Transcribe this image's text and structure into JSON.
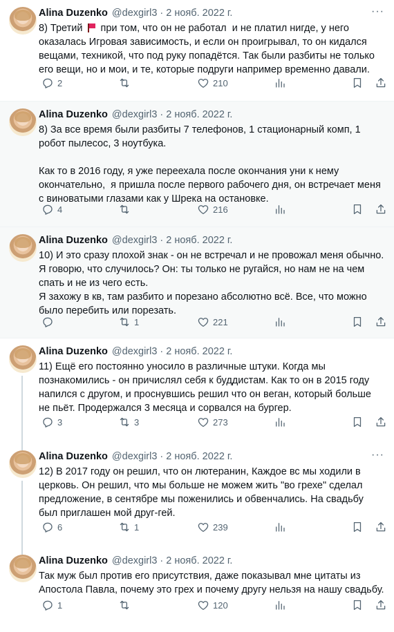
{
  "tweets": [
    {
      "name": "Alina Duzenko",
      "handle": "@dexgirl3",
      "date": "2 нояб. 2022 г.",
      "text_before": "8) Третий ",
      "text_after": " при том, что он не работал  и не платил нигде, у него оказалась Игровая зависимость, и если он проигрывал, то он кидался вещами, техникой, что под руку попадётся. Так были разбиты не только его вещи, но и мои, и те, которые подруги например временно давали.",
      "replies": "2",
      "retweets": "",
      "likes": "210"
    },
    {
      "name": "Alina Duzenko",
      "handle": "@dexgirl3",
      "date": "2 нояб. 2022 г.",
      "text": "8) За все время были разбиты 7 телефонов, 1 стационарный комп, 1 робот пылесос, 3 ноутбука.\n\nКак то в 2016 году, я уже переехала после окончания уни к нему окончательно,  я пришла после первого рабочего дня, он встречает меня с виноватыми глазами как у Шрека на остановке.",
      "replies": "4",
      "retweets": "",
      "likes": "216"
    },
    {
      "name": "Alina Duzenko",
      "handle": "@dexgirl3",
      "date": "2 нояб. 2022 г.",
      "text": "10) И это сразу плохой знак - он не встречал и не провожал меня обычно. Я говорю, что случилось? Он: ты только не ругайся, но нам не на чем спать и не из чего есть.\nЯ захожу в кв, там разбито и порезано абсолютно всё. Все, что можно было перебить или порезать.",
      "replies": "",
      "retweets": "1",
      "likes": "221"
    },
    {
      "name": "Alina Duzenko",
      "handle": "@dexgirl3",
      "date": "2 нояб. 2022 г.",
      "text": "11) Ещё его постоянно уносило в различные штуки. Когда мы познакомились - он причислял себя к буддистам. Как то он в 2015 году напился с другом, и проснувшись решил что он веган, который больше не пьёт. Продержался 3 месяца и сорвался на бургер.",
      "replies": "3",
      "retweets": "3",
      "likes": "273"
    },
    {
      "name": "Alina Duzenko",
      "handle": "@dexgirl3",
      "date": "2 нояб. 2022 г.",
      "text": "12) В 2017 году он решил, что он лютеранин, Каждое вс мы ходили в церковь. Он решил, что мы больше не можем жить \"во грехе\" сделал предложение, в сентябре мы поженились и обвенчались. На свадьбу был приглашен мой друг-гей.",
      "replies": "6",
      "retweets": "1",
      "likes": "239"
    },
    {
      "name": "Alina Duzenko",
      "handle": "@dexgirl3",
      "date": "2 нояб. 2022 г.",
      "text": "Так муж был против его присутствия, даже показывал мне цитаты из Апостола Павла, почему это грех и почему другу нельзя на нашу свадьбу.",
      "replies": "1",
      "retweets": "",
      "likes": "120"
    }
  ],
  "icons": {
    "more": "more-dots-icon",
    "reply": "reply-icon",
    "retweet": "retweet-icon",
    "like": "heart-icon",
    "views": "views-chart-icon",
    "bookmark": "bookmark-icon",
    "share": "share-icon",
    "flag": "red-flag-emoji-icon"
  },
  "colors": {
    "text": "#0f1419",
    "secondary": "#536471",
    "alt_background": "#f7f9f9",
    "thread_line": "#cfd9de"
  }
}
